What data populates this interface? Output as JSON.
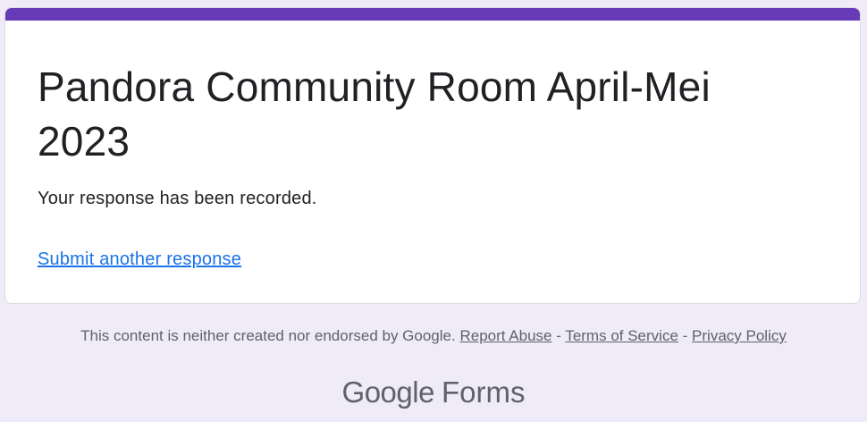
{
  "theme": {
    "accent": "#673ab7",
    "background": "#f0ebf8",
    "link": "#1a73e8"
  },
  "form": {
    "title": "Pandora Community Room April-Mei 2023",
    "confirmation": "Your response has been recorded.",
    "submit_another_label": "Submit another response"
  },
  "footer": {
    "disclaimer_text": "This content is neither created nor endorsed by Google.",
    "report_abuse_label": "Report Abuse",
    "separator": "-",
    "terms_label": "Terms of Service",
    "privacy_label": "Privacy Policy",
    "brand_google": "Google",
    "brand_product": "Forms"
  }
}
